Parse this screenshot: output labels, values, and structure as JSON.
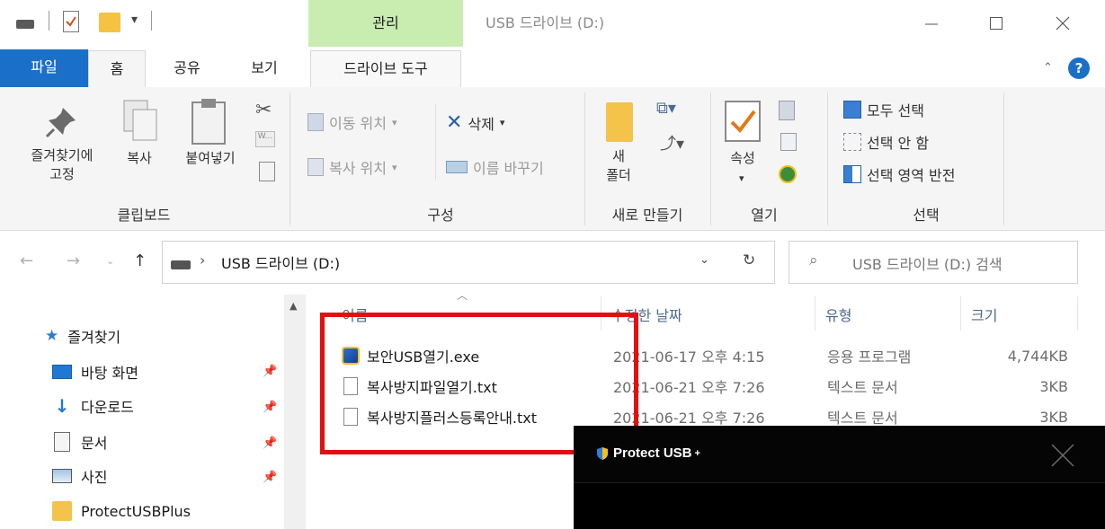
{
  "titlebar": {
    "context_tab": "관리",
    "window_title": "USB 드라이브 (D:)"
  },
  "tabs": {
    "file": "파일",
    "home": "홈",
    "share": "공유",
    "view": "보기",
    "drive_tools": "드라이브 도구"
  },
  "ribbon": {
    "clipboard": {
      "pin_label_line1": "즐겨찾기에",
      "pin_label_line2": "고정",
      "copy": "복사",
      "paste": "붙여넣기",
      "group": "클립보드"
    },
    "organize": {
      "move_to": "이동 위치",
      "copy_to": "복사 위치",
      "delete": "삭제",
      "rename": "이름 바꾸기",
      "group": "구성"
    },
    "new": {
      "new_folder_line1": "새",
      "new_folder_line2": "폴더",
      "group": "새로 만들기"
    },
    "open": {
      "properties": "속성",
      "group": "열기"
    },
    "select": {
      "select_all": "모두 선택",
      "select_none": "선택 안 함",
      "invert": "선택 영역 반전",
      "group": "선택"
    }
  },
  "address": {
    "path": "USB 드라이브 (D:)",
    "search_placeholder": "USB 드라이브 (D:) 검색"
  },
  "nav": {
    "quick_access": "즐겨찾기",
    "items": [
      {
        "label": "바탕 화면",
        "icon": "desktop-icon"
      },
      {
        "label": "다운로드",
        "icon": "download-icon"
      },
      {
        "label": "문서",
        "icon": "documents-icon"
      },
      {
        "label": "사진",
        "icon": "pictures-icon"
      },
      {
        "label": "ProtectUSBPlus",
        "icon": "folder-icon"
      }
    ]
  },
  "columns": {
    "name": "이름",
    "modified": "수정한 날짜",
    "type": "유형",
    "size": "크기"
  },
  "files": [
    {
      "name": "보안USB열기.exe",
      "modified": "2021-06-17 오후 4:15",
      "type": "응용 프로그램",
      "size": "4,744KB",
      "icon": "app-icon"
    },
    {
      "name": "복사방지파일열기.txt",
      "modified": "2021-06-21 오후 7:26",
      "type": "텍스트 문서",
      "size": "3KB",
      "icon": "text-file-icon"
    },
    {
      "name": "복사방지플러스등록안내.txt",
      "modified": "2021-06-21 오후 7:26",
      "type": "텍스트 문서",
      "size": "3KB",
      "icon": "text-file-icon"
    }
  ],
  "overlay": {
    "title": "Protect USB",
    "title_sup": "+"
  },
  "colors": {
    "file_tab": "#1a6fc9",
    "manage_tab": "#c9ecb0",
    "highlight_box": "#e50d0d",
    "overlay_bg": "#000000"
  }
}
